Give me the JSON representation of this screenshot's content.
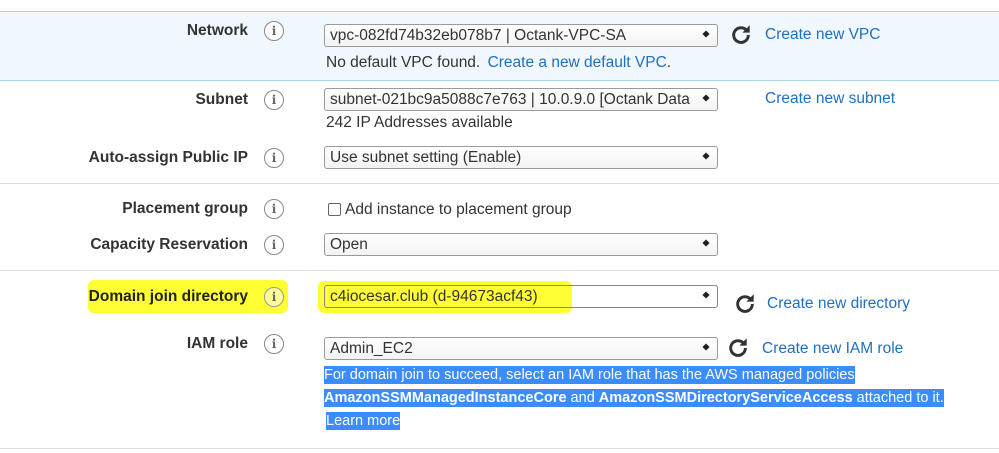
{
  "network": {
    "label": "Network",
    "select_value": "vpc-082fd74b32eb078b7 | Octank-VPC-SA",
    "create_link": "Create new VPC",
    "help_prefix": "No default VPC found.",
    "help_link": "Create a new default VPC",
    "help_suffix": "."
  },
  "subnet": {
    "label": "Subnet",
    "select_value": "subnet-021bc9a5088c7e763 | 10.0.9.0 [Octank Data",
    "create_link": "Create new subnet",
    "help": "242 IP Addresses available"
  },
  "auto_assign_ip": {
    "label": "Auto-assign Public IP",
    "select_value": "Use subnet setting (Enable)"
  },
  "placement_group": {
    "label": "Placement group",
    "checkbox_label": "Add instance to placement group",
    "checked": false
  },
  "capacity_reservation": {
    "label": "Capacity Reservation",
    "select_value": "Open"
  },
  "domain_join": {
    "label": "Domain join directory",
    "select_value": "c4iocesar.club (d-94673acf43)",
    "create_link": "Create new directory",
    "highlight_color": "#ffff33"
  },
  "iam_role": {
    "label": "IAM role",
    "select_value": "Admin_EC2",
    "create_link": "Create new IAM role",
    "help_line1": "For domain join to succeed, select an IAM role that has the AWS managed policies",
    "help_policy1": "AmazonSSMManagedInstanceCore",
    "help_and": " and ",
    "help_policy2": "AmazonSSMDirectoryServiceAccess",
    "help_attached": " attached to it.",
    "help_learn_more": "Learn more",
    "selection_color": "#3b8dff"
  },
  "icons": {
    "info": "info-icon",
    "refresh": "refresh-icon",
    "dropdown": "dropdown-arrow-icon"
  },
  "colors": {
    "link": "#1f6fc0",
    "network_band": "#f0f8fd"
  }
}
